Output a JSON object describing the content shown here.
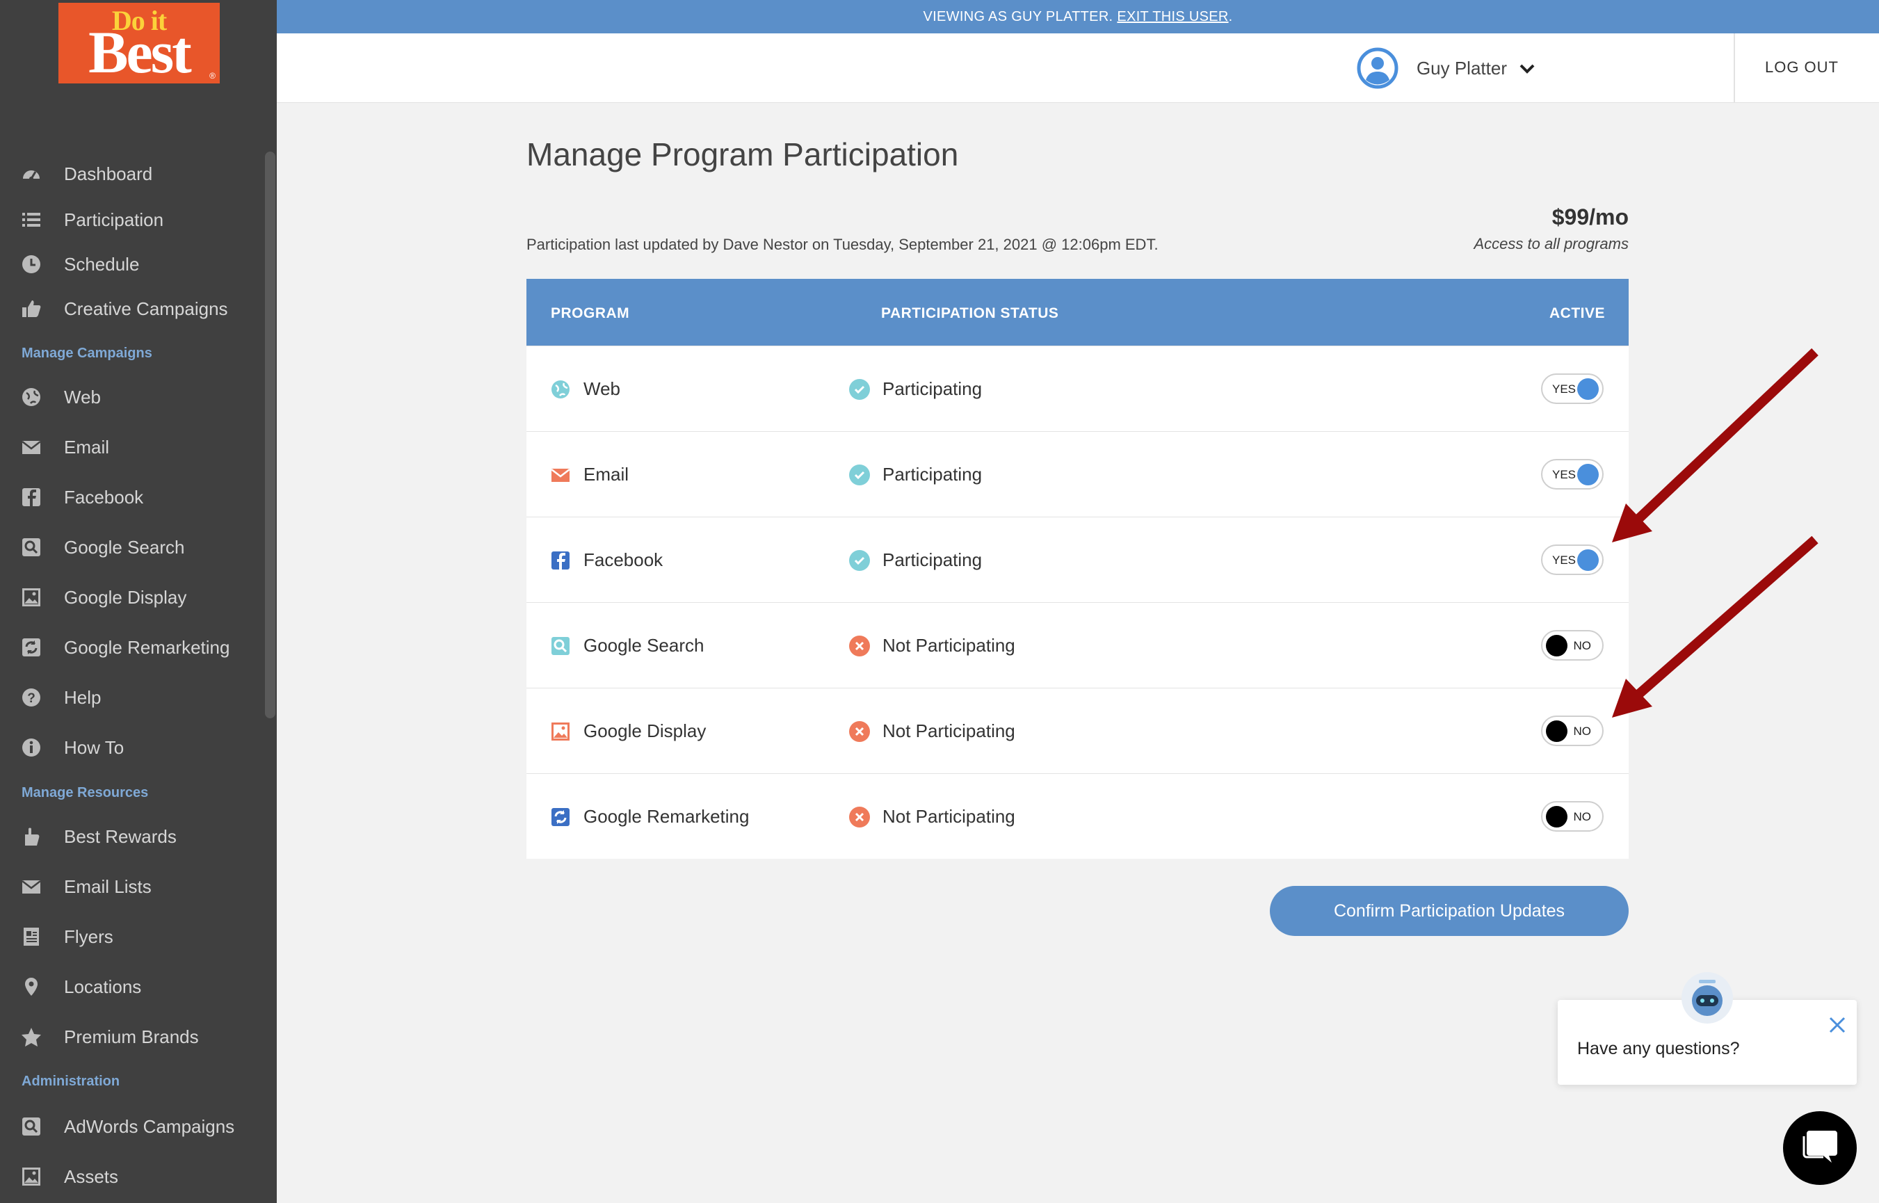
{
  "brand": {
    "logo_line1": "Do it",
    "logo_line2": "Best",
    "logo_reg": "®",
    "accent": "#5b8fc9",
    "logo_color": "#e8562a"
  },
  "banner": {
    "text": "VIEWING AS GUY PLATTER.",
    "link": "EXIT THIS USER",
    "suffix": "."
  },
  "header": {
    "user_name": "Guy Platter",
    "logout": "LOG OUT"
  },
  "sidebar": {
    "items_main": [
      {
        "label": "Dashboard",
        "icon": "dashboard-icon"
      },
      {
        "label": "Participation",
        "icon": "list-icon"
      },
      {
        "label": "Schedule",
        "icon": "clock-icon"
      },
      {
        "label": "Creative Campaigns",
        "icon": "thumbs-up-icon"
      }
    ],
    "section_campaigns": "Manage Campaigns",
    "items_campaigns": [
      {
        "label": "Web",
        "icon": "globe-icon"
      },
      {
        "label": "Email",
        "icon": "envelope-icon"
      },
      {
        "label": "Facebook",
        "icon": "facebook-icon"
      },
      {
        "label": "Google Search",
        "icon": "search-icon"
      },
      {
        "label": "Google Display",
        "icon": "image-icon"
      },
      {
        "label": "Google Remarketing",
        "icon": "refresh-icon"
      },
      {
        "label": "Help",
        "icon": "question-icon"
      },
      {
        "label": "How To",
        "icon": "info-icon"
      }
    ],
    "section_resources": "Manage Resources",
    "items_resources": [
      {
        "label": "Best Rewards",
        "icon": "hand-icon"
      },
      {
        "label": "Email Lists",
        "icon": "envelope-icon"
      },
      {
        "label": "Flyers",
        "icon": "document-icon"
      },
      {
        "label": "Locations",
        "icon": "map-pin-icon"
      },
      {
        "label": "Premium Brands",
        "icon": "star-icon"
      }
    ],
    "section_admin": "Administration",
    "items_admin": [
      {
        "label": "AdWords Campaigns",
        "icon": "search-icon"
      },
      {
        "label": "Assets",
        "icon": "image-icon"
      }
    ]
  },
  "main": {
    "title": "Manage Program Participation",
    "updated_text": "Participation last updated by Dave Nestor on Tuesday, September 21, 2021 @ 12:06pm EDT.",
    "price": "$99/mo",
    "price_sub": "Access to all programs",
    "table": {
      "headers": {
        "program": "PROGRAM",
        "status": "PARTICIPATION STATUS",
        "active": "ACTIVE"
      },
      "rows": [
        {
          "program": "Web",
          "status": "Participating",
          "active": "YES"
        },
        {
          "program": "Email",
          "status": "Participating",
          "active": "YES"
        },
        {
          "program": "Facebook",
          "status": "Participating",
          "active": "YES"
        },
        {
          "program": "Google Search",
          "status": "Not Participating",
          "active": "NO"
        },
        {
          "program": "Google Display",
          "status": "Not Participating",
          "active": "NO"
        },
        {
          "program": "Google Remarketing",
          "status": "Not Participating",
          "active": "NO"
        }
      ]
    },
    "confirm_label": "Confirm Participation Updates"
  },
  "chat": {
    "question": "Have any questions?"
  }
}
